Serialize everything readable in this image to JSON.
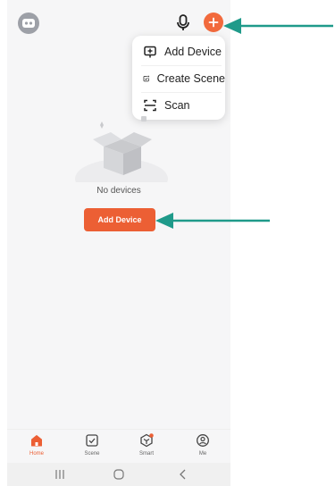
{
  "header": {
    "avatar_icon": "avatar-icon",
    "mic_icon": "microphone-icon",
    "add_icon": "plus-icon",
    "accent_color": "#f26a3d"
  },
  "dropdown": {
    "items": [
      {
        "label": "Add Device",
        "icon": "add-device-icon"
      },
      {
        "label": "Create Scene",
        "icon": "create-scene-icon"
      },
      {
        "label": "Scan",
        "icon": "scan-icon"
      }
    ]
  },
  "main": {
    "empty_text": "No devices",
    "add_button_label": "Add Device"
  },
  "tabs": [
    {
      "label": "Home",
      "icon": "home-icon",
      "active": true
    },
    {
      "label": "Scene",
      "icon": "scene-icon",
      "active": false
    },
    {
      "label": "Smart",
      "icon": "smart-icon",
      "active": false
    },
    {
      "label": "Me",
      "icon": "me-icon",
      "active": false
    }
  ],
  "system_nav": {
    "recents_icon": "recents-icon",
    "home_icon": "home-circle-icon",
    "back_icon": "back-icon"
  },
  "annotation_color": "#1f9a8a"
}
